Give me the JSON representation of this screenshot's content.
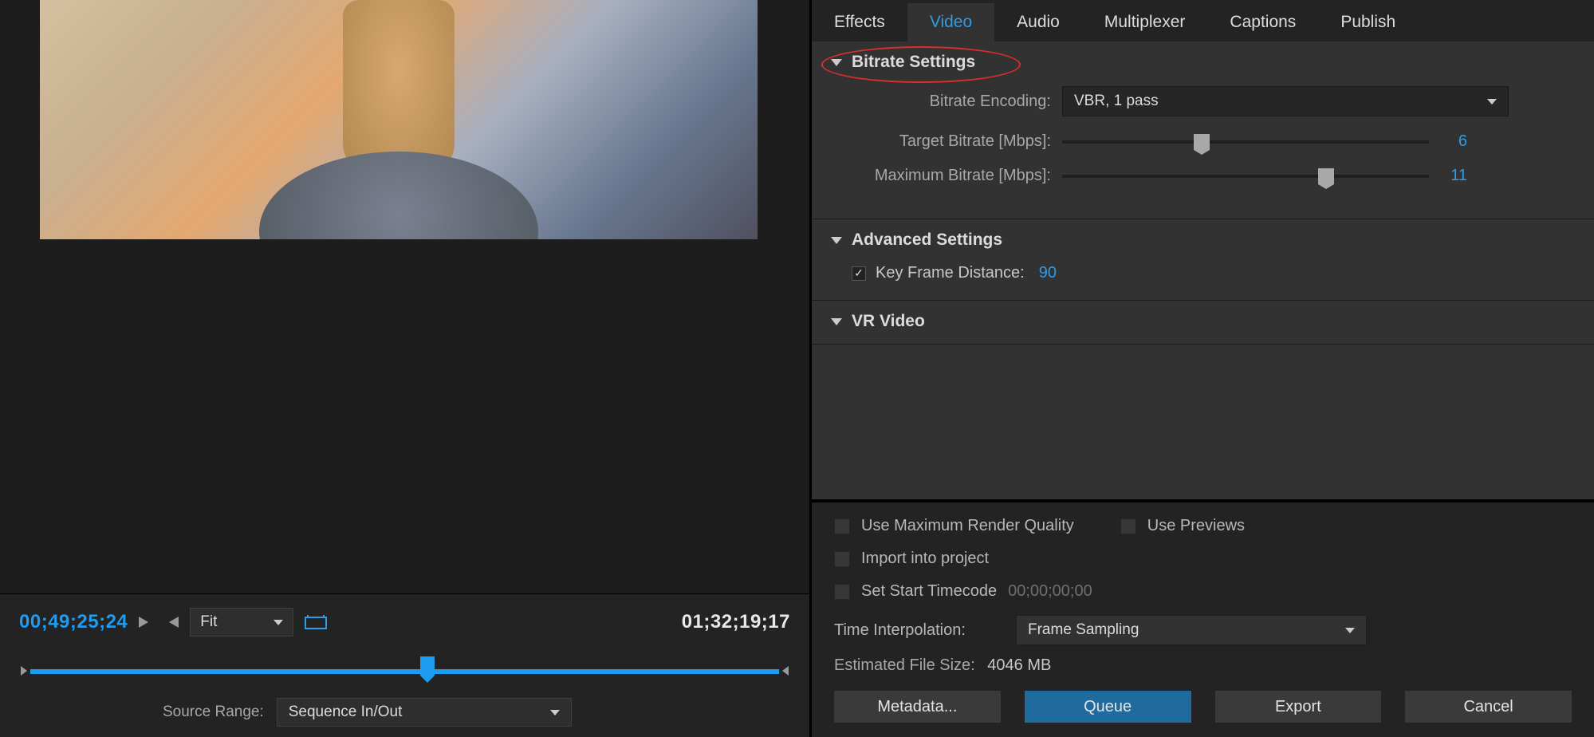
{
  "preview": {
    "timecode_current": "00;49;25;24",
    "timecode_duration": "01;32;19;17",
    "zoom": "Fit",
    "source_range_label": "Source Range:",
    "source_range_value": "Sequence In/Out"
  },
  "tabs": {
    "effects": "Effects",
    "video": "Video",
    "audio": "Audio",
    "multiplexer": "Multiplexer",
    "captions": "Captions",
    "publish": "Publish"
  },
  "bitrate": {
    "section_title": "Bitrate Settings",
    "encoding_label": "Bitrate Encoding:",
    "encoding_value": "VBR, 1 pass",
    "target_label": "Target Bitrate [Mbps]:",
    "target_value": "6",
    "max_label": "Maximum Bitrate [Mbps]:",
    "max_value": "11"
  },
  "advanced": {
    "section_title": "Advanced Settings",
    "kfd_label": "Key Frame Distance:",
    "kfd_value": "90"
  },
  "vr": {
    "section_title": "VR Video"
  },
  "options": {
    "max_render": "Use Maximum Render Quality",
    "use_previews": "Use Previews",
    "import_project": "Import into project",
    "set_start_tc": "Set Start Timecode",
    "start_tc_value": "00;00;00;00",
    "time_interp_label": "Time Interpolation:",
    "time_interp_value": "Frame Sampling",
    "est_label": "Estimated File Size:",
    "est_value": "4046 MB"
  },
  "buttons": {
    "metadata": "Metadata...",
    "queue": "Queue",
    "export": "Export",
    "cancel": "Cancel"
  }
}
